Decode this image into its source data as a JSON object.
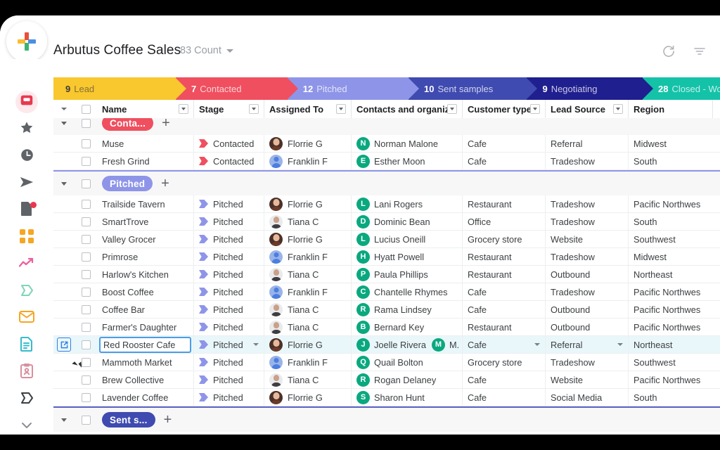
{
  "header": {
    "title": "Arbutus Coffee Sales",
    "count_label": "83 Count",
    "add_icon": "plus-icon",
    "refresh_icon": "refresh-icon",
    "filter_icon": "filter-icon"
  },
  "pipeline": [
    {
      "count": "9",
      "label": "Lead",
      "color": "#f9c72e",
      "dark": true,
      "width": 180
    },
    {
      "count": "7",
      "label": "Contacted",
      "color": "#ef4f5f",
      "dark": false,
      "width": 164
    },
    {
      "count": "12",
      "label": "Pitched",
      "color": "#8e95e8",
      "dark": false,
      "width": 178
    },
    {
      "count": "10",
      "label": "Sent samples",
      "color": "#3f4bb0",
      "dark": false,
      "width": 174
    },
    {
      "count": "9",
      "label": "Negotiating",
      "color": "#1f1f8f",
      "dark": false,
      "width": 170
    },
    {
      "count": "28",
      "label": "Closed - Wo",
      "color": "#14c2a8",
      "dark": false,
      "width": 110
    }
  ],
  "sidebar": {
    "items": [
      {
        "icon": "inbox-icon",
        "active": true,
        "color": "#e8384f",
        "badge": false
      },
      {
        "icon": "star-icon",
        "active": false,
        "color": "#5f6368",
        "badge": false
      },
      {
        "icon": "clock-icon",
        "active": false,
        "color": "#5f6368",
        "badge": false
      },
      {
        "icon": "send-icon",
        "active": false,
        "color": "#5f6368",
        "badge": false
      },
      {
        "icon": "document-icon",
        "active": false,
        "color": "#5f6368",
        "badge": true
      },
      {
        "icon": "grid-icon",
        "active": false,
        "color": "#f5a623",
        "badge": false
      },
      {
        "icon": "trend-up-icon",
        "active": false,
        "color": "#ec5f9e",
        "badge": false
      },
      {
        "icon": "flag-icon",
        "active": false,
        "color": "#7fd4b8",
        "badge": false
      },
      {
        "icon": "mail-icon",
        "active": false,
        "color": "#f5a623",
        "badge": false
      },
      {
        "icon": "file-text-icon",
        "active": false,
        "color": "#36bccc",
        "badge": false
      },
      {
        "icon": "contact-card-icon",
        "active": false,
        "color": "#d98f9e",
        "badge": false
      },
      {
        "icon": "flag-dark-icon",
        "active": false,
        "color": "#3c4043",
        "badge": false
      },
      {
        "icon": "chevron-down-icon",
        "active": false,
        "color": "#8b8f94",
        "badge": false
      }
    ]
  },
  "grid": {
    "columns": [
      {
        "label": "Name",
        "has_filter": true,
        "key": "name"
      },
      {
        "label": "Stage",
        "has_filter": true,
        "key": "stage"
      },
      {
        "label": "Assigned To",
        "has_filter": true,
        "key": "assign"
      },
      {
        "label": "Contacts and organizati",
        "has_filter": true,
        "key": "contact"
      },
      {
        "label": "Customer type",
        "has_filter": true,
        "key": "ctype"
      },
      {
        "label": "Lead Source",
        "has_filter": true,
        "key": "source"
      },
      {
        "label": "Region",
        "has_filter": false,
        "key": "region"
      }
    ],
    "groups": [
      {
        "chip_label": "Conta...",
        "chip_color": "#ef4f5f",
        "accent_color": "#ef4f5f",
        "add_label": "+",
        "rows": [
          {
            "name": "Muse",
            "stage": "Contacted",
            "stage_color": "#ef4f5f",
            "assign": "Florrie G",
            "avatar": "av-f",
            "initial": "N",
            "contact": "Norman Malone",
            "ctype": "Cafe",
            "source": "Referral",
            "region": "Midwest",
            "clipped": true
          },
          {
            "name": "Fresh Grind",
            "stage": "Contacted",
            "stage_color": "#ef4f5f",
            "assign": "Franklin F",
            "avatar": "av-person",
            "initial": "E",
            "contact": "Esther Moon",
            "ctype": "Cafe",
            "source": "Tradeshow",
            "region": "South"
          }
        ]
      },
      {
        "chip_label": "Pitched",
        "chip_color": "#8e95e8",
        "accent_color": "#8e95e8",
        "add_label": "+",
        "rows": [
          {
            "name": "Trailside Tavern",
            "stage": "Pitched",
            "stage_color": "#8e95e8",
            "assign": "Florrie G",
            "avatar": "av-f",
            "initial": "L",
            "contact": "Lani Rogers",
            "ctype": "Restaurant",
            "source": "Tradeshow",
            "region": "Pacific Northwes"
          },
          {
            "name": "SmartTrove",
            "stage": "Pitched",
            "stage_color": "#8e95e8",
            "assign": "Tiana C",
            "avatar": "av-m",
            "initial": "D",
            "contact": "Dominic Bean",
            "ctype": "Office",
            "source": "Tradeshow",
            "region": "South"
          },
          {
            "name": "Valley Grocer",
            "stage": "Pitched",
            "stage_color": "#8e95e8",
            "assign": "Florrie G",
            "avatar": "av-f",
            "initial": "L",
            "contact": "Lucius Oneill",
            "ctype": "Grocery store",
            "source": "Website",
            "region": "Southwest"
          },
          {
            "name": "Primrose",
            "stage": "Pitched",
            "stage_color": "#8e95e8",
            "assign": "Franklin F",
            "avatar": "av-person",
            "initial": "H",
            "contact": "Hyatt Powell",
            "ctype": "Restaurant",
            "source": "Tradeshow",
            "region": "Midwest"
          },
          {
            "name": "Harlow's Kitchen",
            "stage": "Pitched",
            "stage_color": "#8e95e8",
            "assign": "Tiana C",
            "avatar": "av-m",
            "initial": "P",
            "contact": "Paula Phillips",
            "ctype": "Restaurant",
            "source": "Outbound",
            "region": "Northeast"
          },
          {
            "name": "Boost Coffee",
            "stage": "Pitched",
            "stage_color": "#8e95e8",
            "assign": "Franklin F",
            "avatar": "av-person",
            "initial": "C",
            "contact": "Chantelle Rhymes",
            "ctype": "Cafe",
            "source": "Tradeshow",
            "region": "Pacific Northwes"
          },
          {
            "name": "Coffee Bar",
            "stage": "Pitched",
            "stage_color": "#8e95e8",
            "assign": "Tiana C",
            "avatar": "av-m",
            "initial": "R",
            "contact": "Rama Lindsey",
            "ctype": "Cafe",
            "source": "Outbound",
            "region": "Pacific Northwes"
          },
          {
            "name": "Farmer's Daughter",
            "stage": "Pitched",
            "stage_color": "#8e95e8",
            "assign": "Tiana C",
            "avatar": "av-m",
            "initial": "B",
            "contact": "Bernard Key",
            "ctype": "Restaurant",
            "source": "Outbound",
            "region": "Pacific Northwes"
          },
          {
            "name": "Red Rooster Cafe",
            "stage": "Pitched",
            "stage_color": "#8e95e8",
            "assign": "Florrie G",
            "avatar": "av-f",
            "initial": "J",
            "contact": "Joelle Rivera",
            "contact_extra_initial": "M",
            "contact_extra": "M.",
            "ctype": "Cafe",
            "source": "Referral",
            "region": "Northeast",
            "selected": true
          },
          {
            "name": "Mammoth Market",
            "stage": "Pitched",
            "stage_color": "#8e95e8",
            "assign": "Franklin F",
            "avatar": "av-person",
            "initial": "Q",
            "contact": "Quail Bolton",
            "ctype": "Grocery store",
            "source": "Tradeshow",
            "region": "Southwest"
          },
          {
            "name": "Brew Collective",
            "stage": "Pitched",
            "stage_color": "#8e95e8",
            "assign": "Tiana C",
            "avatar": "av-m",
            "initial": "R",
            "contact": "Rogan Delaney",
            "ctype": "Cafe",
            "source": "Website",
            "region": "Pacific Northwes"
          },
          {
            "name": "Lavender Coffee",
            "stage": "Pitched",
            "stage_color": "#8e95e8",
            "assign": "Florrie G",
            "avatar": "av-f",
            "initial": "S",
            "contact": "Sharon Hunt",
            "ctype": "Cafe",
            "source": "Social Media",
            "region": "South"
          }
        ]
      },
      {
        "chip_label": "Sent s...",
        "chip_color": "#3f4bb0",
        "accent_color": "#5b63c4",
        "add_label": "+",
        "rows": []
      }
    ]
  }
}
